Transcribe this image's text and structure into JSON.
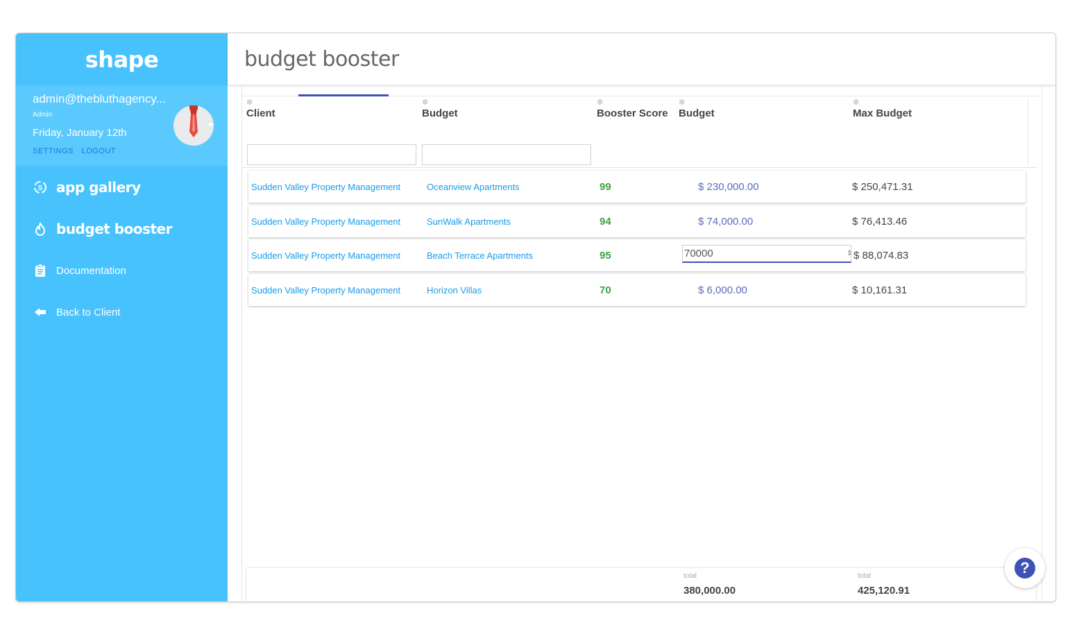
{
  "brand": "shape",
  "user": {
    "email": "admin@thebluthagency...",
    "role": "Admin",
    "date": "Friday, January 12th",
    "settings_label": "SETTINGS",
    "logout_label": "LOGOUT"
  },
  "nav": {
    "items": [
      {
        "label": "app gallery",
        "icon": "app-gallery-icon"
      },
      {
        "label": "budget booster",
        "icon": "flame-icon"
      },
      {
        "label": "Documentation",
        "icon": "clipboard-icon"
      },
      {
        "label": "Back to Client",
        "icon": "arrow-left-icon"
      }
    ]
  },
  "page": {
    "title": "budget booster"
  },
  "table": {
    "headers": [
      "Client",
      "Budget",
      "Booster Score",
      "Budget",
      "Max Budget"
    ],
    "rows": [
      {
        "client": "Sudden Valley Property Management",
        "budget": "Oceanview Apartments",
        "score": "99",
        "budget_amount": "$ 230,000.00",
        "max_budget": "$ 250,471.31"
      },
      {
        "client": "Sudden Valley Property Management",
        "budget": "SunWalk Apartments",
        "score": "94",
        "budget_amount": "$ 74,000.00",
        "max_budget": "$ 76,413.46"
      },
      {
        "client": "Sudden Valley Property Management",
        "budget": "Beach Terrace Apartments",
        "score": "95",
        "budget_amount": "70000",
        "max_budget": "$ 88,074.83"
      },
      {
        "client": "Sudden Valley Property Management",
        "budget": "Horizon Villas",
        "score": "70",
        "budget_amount": "$ 6,000.00",
        "max_budget": "$ 10,161.31"
      }
    ]
  },
  "totals": {
    "label": "total",
    "budget_total": "380,000.00",
    "max_total": "425,120.91"
  },
  "colors": {
    "sidebar": "#47c2fd",
    "accent": "#3f51b5",
    "score": "#43a047",
    "link": "#1a9be6"
  }
}
